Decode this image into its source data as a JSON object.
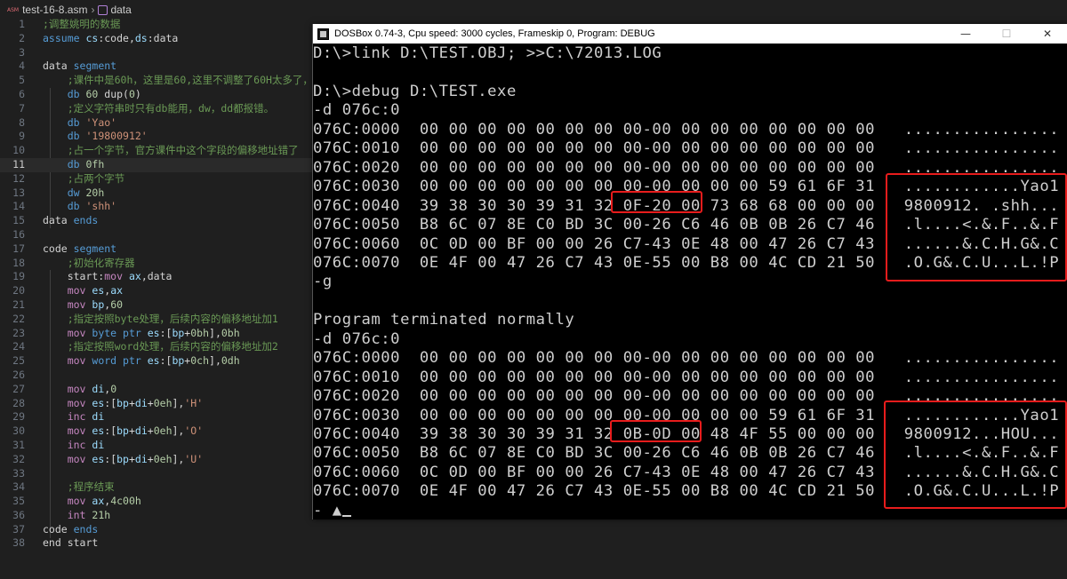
{
  "editor": {
    "file_name": "test-16-8.asm",
    "file_badge": "ASM",
    "breadcrumb_symbol": "data",
    "current_line": 11,
    "lines": [
      {
        "n": "1",
        "segs": [
          [
            "cm",
            ";调整姚明的数据"
          ]
        ]
      },
      {
        "n": "2",
        "segs": [
          [
            "kw",
            "assume "
          ],
          [
            "reg",
            "cs"
          ],
          [
            "ctext",
            ":code,"
          ],
          [
            "reg",
            "ds"
          ],
          [
            "ctext",
            ":data"
          ]
        ]
      },
      {
        "n": "3",
        "segs": []
      },
      {
        "n": "4",
        "segs": [
          [
            "ctext",
            "data "
          ],
          [
            "kw",
            "segment"
          ]
        ]
      },
      {
        "n": "5",
        "segs": [
          [
            "ctext",
            "    "
          ],
          [
            "cm",
            ";课件中是60h，这里是60,这里不调整了60H太多了，"
          ]
        ]
      },
      {
        "n": "6",
        "segs": [
          [
            "ctext",
            "    "
          ],
          [
            "kw",
            "db "
          ],
          [
            "num",
            "60 "
          ],
          [
            "ctext",
            "dup("
          ],
          [
            "num",
            "0"
          ],
          [
            "ctext",
            ")"
          ]
        ]
      },
      {
        "n": "7",
        "segs": [
          [
            "ctext",
            "    "
          ],
          [
            "cm",
            ";定义字符串时只有db能用，dw，dd都报错。"
          ]
        ]
      },
      {
        "n": "8",
        "segs": [
          [
            "ctext",
            "    "
          ],
          [
            "kw",
            "db "
          ],
          [
            "str",
            "'Yao'"
          ]
        ]
      },
      {
        "n": "9",
        "segs": [
          [
            "ctext",
            "    "
          ],
          [
            "kw",
            "db "
          ],
          [
            "str",
            "'19800912'"
          ]
        ]
      },
      {
        "n": "10",
        "segs": [
          [
            "ctext",
            "    "
          ],
          [
            "cm",
            ";占一个字节，官方课件中这个字段的偏移地址错了"
          ]
        ]
      },
      {
        "n": "11",
        "segs": [
          [
            "ctext",
            "    "
          ],
          [
            "kw",
            "db "
          ],
          [
            "num",
            "0fh"
          ]
        ]
      },
      {
        "n": "12",
        "segs": [
          [
            "ctext",
            "    "
          ],
          [
            "cm",
            ";占两个字节"
          ]
        ]
      },
      {
        "n": "13",
        "segs": [
          [
            "ctext",
            "    "
          ],
          [
            "kw",
            "dw "
          ],
          [
            "num",
            "20h"
          ]
        ]
      },
      {
        "n": "14",
        "segs": [
          [
            "ctext",
            "    "
          ],
          [
            "kw",
            "db "
          ],
          [
            "str",
            "'shh'"
          ]
        ]
      },
      {
        "n": "15",
        "segs": [
          [
            "ctext",
            "data "
          ],
          [
            "kw",
            "ends"
          ]
        ]
      },
      {
        "n": "16",
        "segs": []
      },
      {
        "n": "17",
        "segs": [
          [
            "ctext",
            "code "
          ],
          [
            "kw",
            "segment"
          ]
        ]
      },
      {
        "n": "18",
        "segs": [
          [
            "ctext",
            "    "
          ],
          [
            "cm",
            ";初始化寄存器"
          ]
        ]
      },
      {
        "n": "19",
        "segs": [
          [
            "ctext",
            "    start:"
          ],
          [
            "ins",
            "mov "
          ],
          [
            "reg",
            "ax"
          ],
          [
            "ctext",
            ",data"
          ]
        ]
      },
      {
        "n": "20",
        "segs": [
          [
            "ctext",
            "    "
          ],
          [
            "ins",
            "mov "
          ],
          [
            "reg",
            "es"
          ],
          [
            "ctext",
            ","
          ],
          [
            "reg",
            "ax"
          ]
        ]
      },
      {
        "n": "21",
        "segs": [
          [
            "ctext",
            "    "
          ],
          [
            "ins",
            "mov "
          ],
          [
            "reg",
            "bp"
          ],
          [
            "ctext",
            ","
          ],
          [
            "num",
            "60"
          ]
        ]
      },
      {
        "n": "22",
        "segs": [
          [
            "ctext",
            "    "
          ],
          [
            "cm",
            ";指定按照byte处理，后续内容的偏移地址加1"
          ]
        ]
      },
      {
        "n": "23",
        "segs": [
          [
            "ctext",
            "    "
          ],
          [
            "ins",
            "mov "
          ],
          [
            "kw",
            "byte ptr "
          ],
          [
            "reg",
            "es"
          ],
          [
            "ctext",
            ":["
          ],
          [
            "reg",
            "bp"
          ],
          [
            "ctext",
            "+"
          ],
          [
            "num",
            "0bh"
          ],
          [
            "ctext",
            "],"
          ],
          [
            "num",
            "0bh"
          ]
        ]
      },
      {
        "n": "24",
        "segs": [
          [
            "ctext",
            "    "
          ],
          [
            "cm",
            ";指定按照word处理，后续内容的偏移地址加2"
          ]
        ]
      },
      {
        "n": "25",
        "segs": [
          [
            "ctext",
            "    "
          ],
          [
            "ins",
            "mov "
          ],
          [
            "kw",
            "word ptr "
          ],
          [
            "reg",
            "es"
          ],
          [
            "ctext",
            ":["
          ],
          [
            "reg",
            "bp"
          ],
          [
            "ctext",
            "+"
          ],
          [
            "num",
            "0ch"
          ],
          [
            "ctext",
            "],"
          ],
          [
            "num",
            "0dh"
          ]
        ]
      },
      {
        "n": "26",
        "segs": []
      },
      {
        "n": "27",
        "segs": [
          [
            "ctext",
            "    "
          ],
          [
            "ins",
            "mov "
          ],
          [
            "reg",
            "di"
          ],
          [
            "ctext",
            ","
          ],
          [
            "num",
            "0"
          ]
        ]
      },
      {
        "n": "28",
        "segs": [
          [
            "ctext",
            "    "
          ],
          [
            "ins",
            "mov "
          ],
          [
            "reg",
            "es"
          ],
          [
            "ctext",
            ":["
          ],
          [
            "reg",
            "bp"
          ],
          [
            "ctext",
            "+"
          ],
          [
            "reg",
            "di"
          ],
          [
            "ctext",
            "+"
          ],
          [
            "num",
            "0eh"
          ],
          [
            "ctext",
            "],"
          ],
          [
            "str",
            "'H'"
          ]
        ]
      },
      {
        "n": "29",
        "segs": [
          [
            "ctext",
            "    "
          ],
          [
            "ins",
            "inc "
          ],
          [
            "reg",
            "di"
          ]
        ]
      },
      {
        "n": "30",
        "segs": [
          [
            "ctext",
            "    "
          ],
          [
            "ins",
            "mov "
          ],
          [
            "reg",
            "es"
          ],
          [
            "ctext",
            ":["
          ],
          [
            "reg",
            "bp"
          ],
          [
            "ctext",
            "+"
          ],
          [
            "reg",
            "di"
          ],
          [
            "ctext",
            "+"
          ],
          [
            "num",
            "0eh"
          ],
          [
            "ctext",
            "],"
          ],
          [
            "str",
            "'O'"
          ]
        ]
      },
      {
        "n": "31",
        "segs": [
          [
            "ctext",
            "    "
          ],
          [
            "ins",
            "inc "
          ],
          [
            "reg",
            "di"
          ]
        ]
      },
      {
        "n": "32",
        "segs": [
          [
            "ctext",
            "    "
          ],
          [
            "ins",
            "mov "
          ],
          [
            "reg",
            "es"
          ],
          [
            "ctext",
            ":["
          ],
          [
            "reg",
            "bp"
          ],
          [
            "ctext",
            "+"
          ],
          [
            "reg",
            "di"
          ],
          [
            "ctext",
            "+"
          ],
          [
            "num",
            "0eh"
          ],
          [
            "ctext",
            "],"
          ],
          [
            "str",
            "'U'"
          ]
        ]
      },
      {
        "n": "33",
        "segs": []
      },
      {
        "n": "34",
        "segs": [
          [
            "ctext",
            "    "
          ],
          [
            "cm",
            ";程序结束"
          ]
        ]
      },
      {
        "n": "35",
        "segs": [
          [
            "ctext",
            "    "
          ],
          [
            "ins",
            "mov "
          ],
          [
            "reg",
            "ax"
          ],
          [
            "ctext",
            ","
          ],
          [
            "num",
            "4c00h"
          ]
        ]
      },
      {
        "n": "36",
        "segs": [
          [
            "ctext",
            "    "
          ],
          [
            "ins",
            "int "
          ],
          [
            "num",
            "21h"
          ]
        ]
      },
      {
        "n": "37",
        "segs": [
          [
            "ctext",
            "code "
          ],
          [
            "kw",
            "ends"
          ]
        ]
      },
      {
        "n": "38",
        "segs": [
          [
            "ctext",
            "end start"
          ]
        ]
      }
    ]
  },
  "dosbox": {
    "title": "DOSBox 0.74-3, Cpu speed:     3000 cycles, Frameskip  0, Program:    DEBUG",
    "minimize": "—",
    "maximize": "☐",
    "close": "✕",
    "lines": [
      "D:\\>link D:\\TEST.OBJ; >>C:\\72013.LOG",
      "",
      "D:\\>debug D:\\TEST.exe",
      "-d 076c:0",
      "076C:0000  00 00 00 00 00 00 00 00-00 00 00 00 00 00 00 00   ................",
      "076C:0010  00 00 00 00 00 00 00 00-00 00 00 00 00 00 00 00   ................",
      "076C:0020  00 00 00 00 00 00 00 00-00 00 00 00 00 00 00 00   ................",
      "076C:0030  00 00 00 00 00 00 00 00-00 00 00 00 59 61 6F 31   ............Yao1",
      "076C:0040  39 38 30 30 39 31 32 0F-20 00 73 68 68 00 00 00   9800912. .shh...",
      "076C:0050  B8 6C 07 8E C0 BD 3C 00-26 C6 46 0B 0B 26 C7 46   .l....<.&.F..&.F",
      "076C:0060  0C 0D 00 BF 00 00 26 C7-43 0E 48 00 47 26 C7 43   ......&.C.H.G&.C",
      "076C:0070  0E 4F 00 47 26 C7 43 0E-55 00 B8 00 4C CD 21 50   .O.G&.C.U...L.!P",
      "-g",
      "",
      "Program terminated normally",
      "-d 076c:0",
      "076C:0000  00 00 00 00 00 00 00 00-00 00 00 00 00 00 00 00   ................",
      "076C:0010  00 00 00 00 00 00 00 00-00 00 00 00 00 00 00 00   ................",
      "076C:0020  00 00 00 00 00 00 00 00-00 00 00 00 00 00 00 00   ................",
      "076C:0030  00 00 00 00 00 00 00 00-00 00 00 00 59 61 6F 31   ............Yao1",
      "076C:0040  39 38 30 30 39 31 32 0B-0D 00 48 4F 55 00 00 00   9800912...HOU...",
      "076C:0050  B8 6C 07 8E C0 BD 3C 00-26 C6 46 0B 0B 26 C7 46   .l....<.&.F..&.F",
      "076C:0060  0C 0D 00 BF 00 00 26 C7-43 0E 48 00 47 26 C7 43   ......&.C.H.G&.C",
      "076C:0070  0E 4F 00 47 26 C7 43 0E-55 00 B8 00 4C CD 21 50   .O.G&.C.U...L.!P",
      "- ▲"
    ]
  }
}
